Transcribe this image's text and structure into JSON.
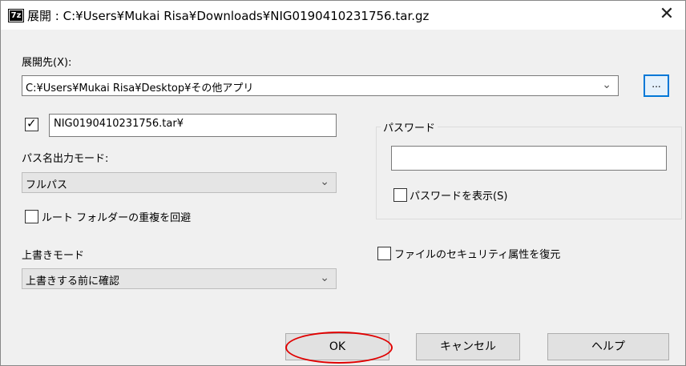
{
  "window": {
    "icon_text": "7z",
    "title": "展開 : C:¥Users¥Mukai Risa¥Downloads¥NIG0190410231756.tar.gz",
    "close_glyph": "✕"
  },
  "destination": {
    "label": "展開先(X):",
    "value": "C:¥Users¥Mukai Risa¥Desktop¥その他アプリ",
    "browse_label": "..."
  },
  "subfolder": {
    "checked": true,
    "check_glyph": "✓",
    "value": "NIG0190410231756.tar¥"
  },
  "path_mode": {
    "label": "パス名出力モード:",
    "value": "フルパス"
  },
  "avoid_dup": {
    "label": "ルート フォルダーの重複を回避",
    "checked": false
  },
  "overwrite": {
    "label": "上書きモード",
    "value": "上書きする前に確認"
  },
  "password": {
    "group_label": "パスワード",
    "value": "",
    "show_label": "パスワードを表示(S)",
    "show_checked": false
  },
  "security": {
    "label": "ファイルのセキュリティ属性を復元",
    "checked": false
  },
  "buttons": {
    "ok": "OK",
    "cancel": "キャンセル",
    "help": "ヘルプ"
  },
  "icons": {
    "dropdown": "chevron-down-icon",
    "close": "close-icon",
    "app": "7zip-icon"
  },
  "colors": {
    "accent": "#0078d7",
    "highlight_annotation": "#e00000"
  }
}
